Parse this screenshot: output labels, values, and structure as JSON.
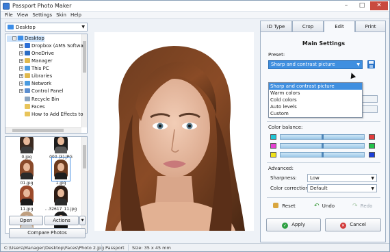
{
  "window": {
    "title": "Passport Photo Maker"
  },
  "menu": [
    "File",
    "View",
    "Settings",
    "Skin",
    "Help"
  ],
  "folder_select": {
    "value": "Desktop"
  },
  "tree": [
    {
      "label": "Desktop",
      "expander": "−",
      "icon": "folder-icon",
      "color": "#3d8ee8"
    },
    {
      "label": "Dropbox (AMS Softwa",
      "expander": "+",
      "icon": "dropbox-icon",
      "color": "#2d6fd6"
    },
    {
      "label": "OneDrive",
      "expander": "+",
      "icon": "cloud-icon",
      "color": "#2b6cc4"
    },
    {
      "label": "Manager",
      "expander": "+",
      "icon": "user-folder-icon",
      "color": "#e0b94d"
    },
    {
      "label": "This PC",
      "expander": "+",
      "icon": "computer-icon",
      "color": "#4a9be0"
    },
    {
      "label": "Libraries",
      "expander": "+",
      "icon": "library-icon",
      "color": "#e0b94d"
    },
    {
      "label": "Network",
      "expander": "+",
      "icon": "network-icon",
      "color": "#4a9be0"
    },
    {
      "label": "Control Panel",
      "expander": "+",
      "icon": "control-panel-icon",
      "color": "#5d8fd0"
    },
    {
      "label": "Recycle Bin",
      "expander": "",
      "icon": "recycle-bin-icon",
      "color": "#8aa4c0"
    },
    {
      "label": "Faces",
      "expander": "",
      "icon": "folder-icon",
      "color": "#e8c45a"
    },
    {
      "label": "How to Add Effects to",
      "expander": "",
      "icon": "folder-icon",
      "color": "#e8c45a"
    }
  ],
  "thumbnails": [
    {
      "label": "0.jpg",
      "hair": "#3b2a20",
      "body": "#3d3d3d",
      "selected": false
    },
    {
      "label": "000 (3).JPG",
      "hair": "#1c1c1c",
      "body": "#5a5a5a",
      "selected": false
    },
    {
      "label": "01.jpg",
      "hair": "#8a4a2a",
      "body": "#2a2a2a",
      "selected": false
    },
    {
      "label": "1.jpg",
      "hair": "#6b3a1e",
      "body": "#1d1d1d",
      "selected": true
    },
    {
      "label": "11.jpg",
      "hair": "#9c4b2c",
      "body": "#1a1a1a",
      "selected": false
    },
    {
      "label": "...32617_11.jpg",
      "hair": "#2d1c14",
      "body": "#2b2b2b",
      "selected": false
    },
    {
      "label": "",
      "hair": "#c0a080",
      "body": "#cfcfcf",
      "selected": false
    },
    {
      "label": "",
      "hair": "#1a1a1a",
      "body": "#111111",
      "selected": false
    }
  ],
  "left_buttons": {
    "open": "Open",
    "actions": "Actions",
    "compare": "Compare Photos"
  },
  "tabs": [
    {
      "label": "ID Type",
      "active": false
    },
    {
      "label": "Crop",
      "active": false
    },
    {
      "label": "Edit",
      "active": true
    },
    {
      "label": "Print",
      "active": false
    }
  ],
  "settings": {
    "title": "Main Settings",
    "preset_label": "Preset:",
    "preset_value": "Sharp and contrast picture",
    "preset_options": [
      "Sharp and contrast picture",
      "Warm colors",
      "Cold colors",
      "Auto levels",
      "Custom"
    ],
    "color_balance_label": "Color balance:",
    "balance": [
      {
        "left": "#1fc6d6",
        "right": "#e23b3b",
        "level": 0.5
      },
      {
        "left": "#e43fd2",
        "right": "#23c24a",
        "level": 0.5
      },
      {
        "left": "#f0e21a",
        "right": "#1b3fd8",
        "level": 0.5
      }
    ],
    "advanced_label": "Advanced:",
    "sharpness_label": "Sharpness:",
    "sharpness_value": "Low",
    "correction_label": "Color correction:",
    "correction_value": "Default"
  },
  "actions": {
    "reset": "Reset",
    "undo": "Undo",
    "redo": "Redo",
    "apply": "Apply",
    "cancel": "Cancel"
  },
  "status": {
    "path": "C:\\Users\\Manager\\Desktop\\Faces\\Photo 2.jpg",
    "type": "Passport",
    "size": "Size: 35 x 45 mm"
  },
  "accent": "#3f8fe0"
}
